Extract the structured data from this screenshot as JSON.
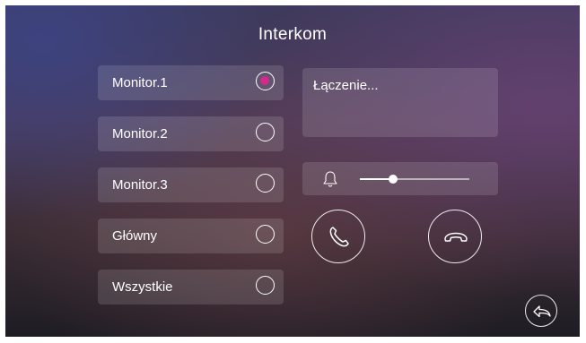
{
  "screen": {
    "title": "Interkom"
  },
  "monitors": [
    {
      "label": "Monitor.1",
      "selected": true
    },
    {
      "label": "Monitor.2",
      "selected": false
    },
    {
      "label": "Monitor.3",
      "selected": false
    },
    {
      "label": "Główny",
      "selected": false
    },
    {
      "label": "Wszystkie",
      "selected": false
    }
  ],
  "status": {
    "text": "Łączenie..."
  },
  "volume": {
    "level": 0.3,
    "icon": "bell-icon"
  },
  "actions": {
    "answer_icon": "phone-answer-icon",
    "hangup_icon": "phone-hangup-icon",
    "back_icon": "back-arrow-icon"
  },
  "colors": {
    "accent": "#d12a8a",
    "text": "#ffffff"
  }
}
